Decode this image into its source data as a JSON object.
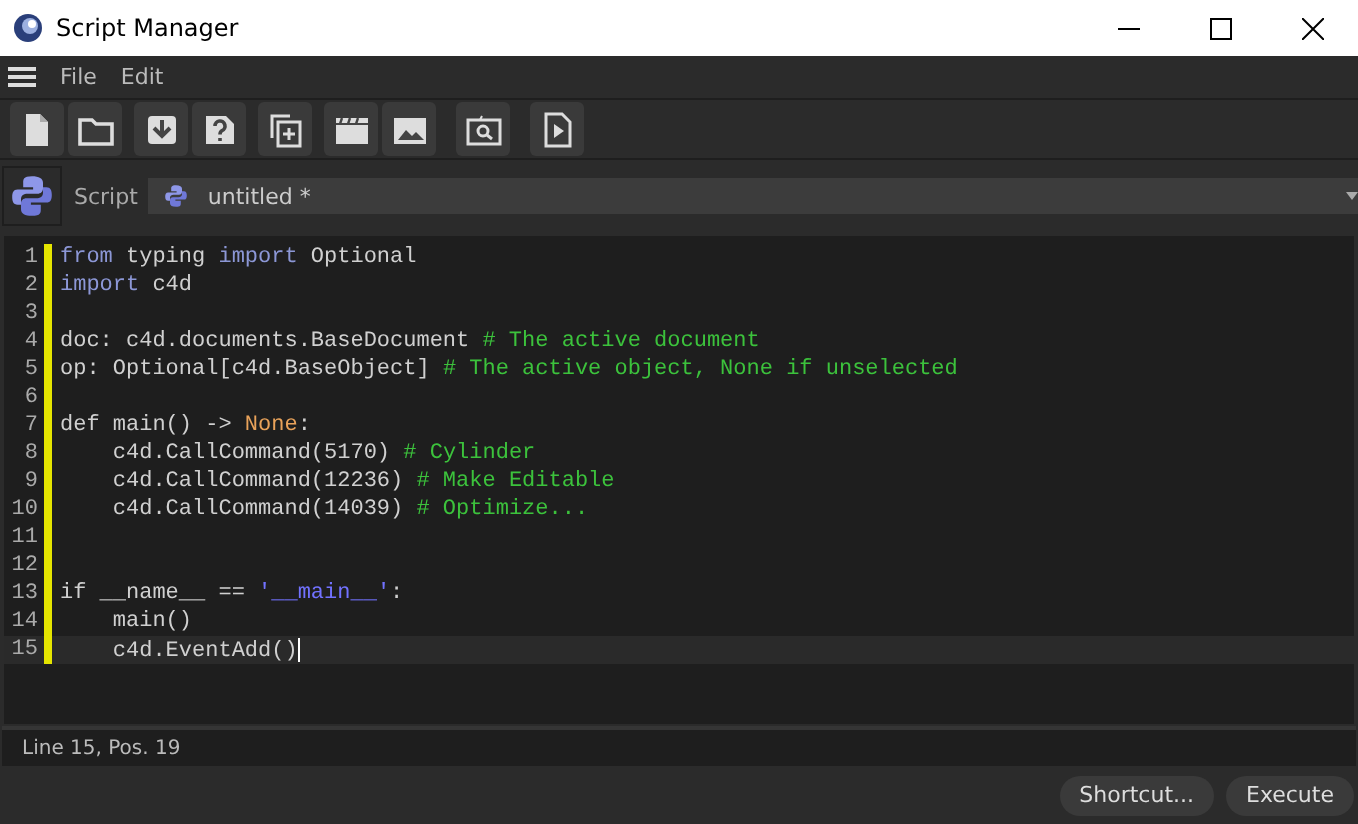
{
  "window": {
    "title": "Script Manager"
  },
  "menu": [
    "File",
    "Edit"
  ],
  "toolbar": [
    {
      "kind": "new"
    },
    {
      "kind": "open"
    },
    {
      "kind": "download"
    },
    {
      "kind": "help"
    },
    {
      "kind": "duplicate"
    },
    {
      "kind": "clapper"
    },
    {
      "kind": "image"
    },
    {
      "kind": "find"
    },
    {
      "kind": "play"
    }
  ],
  "script_bar": {
    "label": "Script",
    "selector": "untitled *"
  },
  "editor": {
    "lines": [
      {
        "number": "1",
        "current": false,
        "tokens": [
          {
            "kind": "keyword",
            "text": "from"
          },
          {
            "kind": "plain",
            "text": " typing "
          },
          {
            "kind": "keyword",
            "text": "import"
          },
          {
            "kind": "plain",
            "text": " Optional"
          }
        ]
      },
      {
        "number": "2",
        "current": false,
        "tokens": [
          {
            "kind": "keyword",
            "text": "import"
          },
          {
            "kind": "plain",
            "text": " c4d"
          }
        ]
      },
      {
        "number": "3",
        "current": false
      },
      {
        "number": "4",
        "current": false,
        "tokens": [
          {
            "kind": "plain",
            "text": "doc: c4d.documents.BaseDocument "
          },
          {
            "kind": "comment",
            "text": "# The active document"
          }
        ]
      },
      {
        "number": "5",
        "current": false,
        "tokens": [
          {
            "kind": "plain",
            "text": "op: Optional[c4d.BaseObject] "
          },
          {
            "kind": "comment",
            "text": "# The active object, None if unselected"
          }
        ]
      },
      {
        "number": "6",
        "current": false
      },
      {
        "number": "7",
        "current": false,
        "tokens": [
          {
            "kind": "plain",
            "text": "def main() -> "
          },
          {
            "kind": "constant",
            "text": "None"
          },
          {
            "kind": "plain",
            "text": ":"
          }
        ]
      },
      {
        "number": "8",
        "current": false,
        "tokens": [
          {
            "kind": "plain",
            "text": "    c4d.CallCommand(5170) "
          },
          {
            "kind": "comment",
            "text": "# Cylinder"
          }
        ]
      },
      {
        "number": "9",
        "current": false,
        "tokens": [
          {
            "kind": "plain",
            "text": "    c4d.CallCommand(12236) "
          },
          {
            "kind": "comment",
            "text": "# Make Editable"
          }
        ]
      },
      {
        "number": "10",
        "current": false,
        "tokens": [
          {
            "kind": "plain",
            "text": "    c4d.CallCommand(14039) "
          },
          {
            "kind": "comment",
            "text": "# Optimize..."
          }
        ]
      },
      {
        "number": "11",
        "current": false
      },
      {
        "number": "12",
        "current": false
      },
      {
        "number": "13",
        "current": false,
        "tokens": [
          {
            "kind": "plain",
            "text": "if __name__ == "
          },
          {
            "kind": "string",
            "text": "'__main__'"
          },
          {
            "kind": "plain",
            "text": ":"
          }
        ]
      },
      {
        "number": "14",
        "current": false,
        "tokens": [
          {
            "kind": "plain",
            "text": "    main()"
          }
        ]
      },
      {
        "number": "15",
        "current": true,
        "tokens": [
          {
            "kind": "plain",
            "text": "    c4d.EventAdd()"
          }
        ]
      }
    ]
  },
  "status_bar": "Line 15, Pos. 19",
  "buttons": [
    "Shortcut...",
    "Execute"
  ]
}
